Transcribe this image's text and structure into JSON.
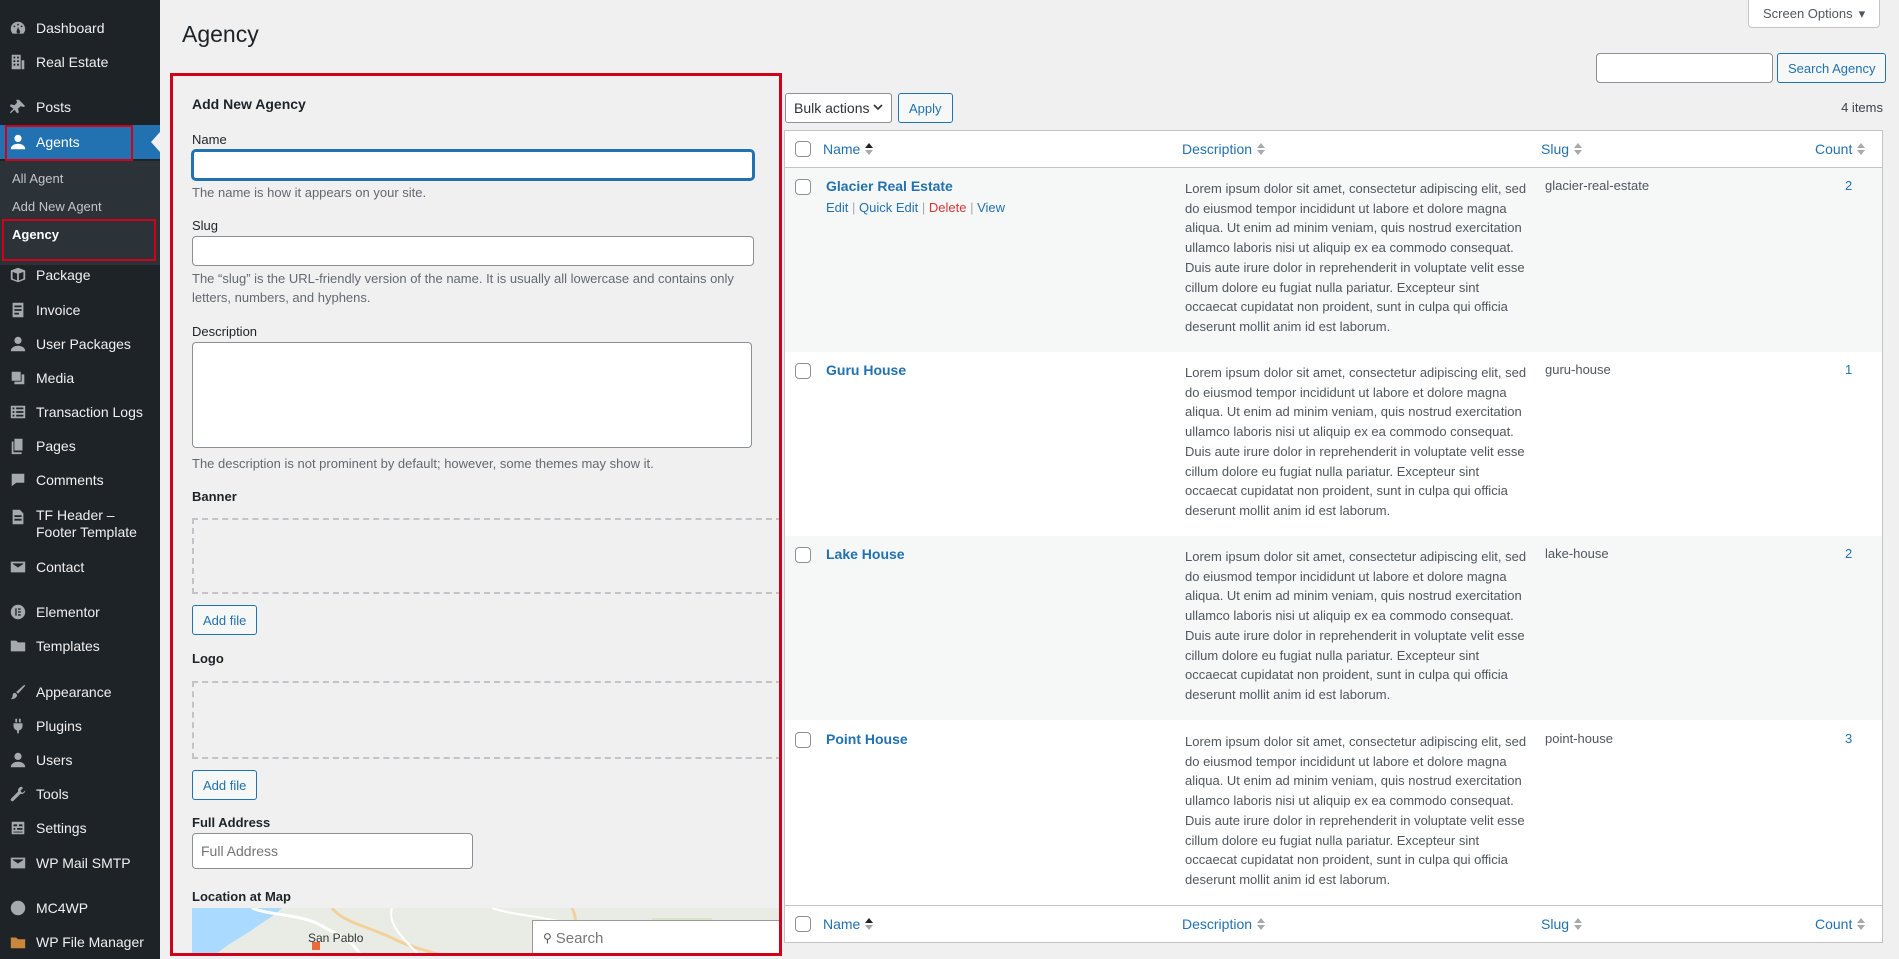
{
  "admin_menu": {
    "items": [
      {
        "label": "Dashboard",
        "icon": "dashboard-icon"
      },
      {
        "label": "Real Estate",
        "icon": "building-icon"
      },
      {
        "label": "Posts",
        "icon": "pushpin-icon"
      },
      {
        "label": "Agents",
        "icon": "user-icon"
      },
      {
        "label": "Package",
        "icon": "package-icon"
      },
      {
        "label": "Invoice",
        "icon": "invoice-icon"
      },
      {
        "label": "User Packages",
        "icon": "user-icon"
      },
      {
        "label": "Media",
        "icon": "media-icon"
      },
      {
        "label": "Transaction Logs",
        "icon": "list-icon"
      },
      {
        "label": "Pages",
        "icon": "pages-icon"
      },
      {
        "label": "Comments",
        "icon": "comment-icon"
      },
      {
        "label": "TF Header –\nFooter Template",
        "icon": "document-icon"
      },
      {
        "label": "Contact",
        "icon": "mail-icon"
      },
      {
        "label": "Elementor",
        "icon": "elementor-icon"
      },
      {
        "label": "Templates",
        "icon": "folder-icon"
      },
      {
        "label": "Appearance",
        "icon": "paintbrush-icon"
      },
      {
        "label": "Plugins",
        "icon": "plugin-icon"
      },
      {
        "label": "Users",
        "icon": "users-icon"
      },
      {
        "label": "Tools",
        "icon": "wrench-icon"
      },
      {
        "label": "Settings",
        "icon": "settings-icon"
      },
      {
        "label": "WP Mail SMTP",
        "icon": "mail-icon"
      },
      {
        "label": "MC4WP",
        "icon": "mc4wp-icon"
      },
      {
        "label": "WP File Manager",
        "icon": "file-manager-icon"
      }
    ],
    "submenu": [
      "All Agent",
      "Add New Agent",
      "Agency"
    ],
    "accent_color": "#2271b1",
    "background_color": "#1d2327"
  },
  "page": {
    "title": "Agency",
    "screen_options": "Screen Options"
  },
  "add_form": {
    "heading": "Add New Agency",
    "name_label": "Name",
    "name_value": "",
    "name_hint": "The name is how it appears on your site.",
    "slug_label": "Slug",
    "slug_value": "",
    "slug_hint": "The “slug” is the URL-friendly version of the name. It is usually all lowercase and contains only letters, numbers, and hyphens.",
    "description_label": "Description",
    "description_hint": "The description is not prominent by default; however, some themes may show it.",
    "banner_label": "Banner",
    "logo_label": "Logo",
    "add_file_label": "Add file",
    "address_label": "Full Address",
    "address_placeholder": "Full Address",
    "map_label": "Location at Map",
    "map_city": "San Pablo",
    "map_search_placeholder": "Search"
  },
  "list": {
    "search_button": "Search Agency",
    "search_value": "",
    "bulk_actions": "Bulk actions",
    "apply": "Apply",
    "items_count": "4 items",
    "columns": {
      "name": "Name",
      "description": "Description",
      "slug": "Slug",
      "count": "Count"
    },
    "row_actions": [
      "Edit",
      "Quick Edit",
      "Delete",
      "View"
    ],
    "rows": [
      {
        "name": "Glacier Real Estate",
        "description": "Lorem ipsum dolor sit amet, consectetur adipiscing elit, sed do eiusmod tempor incididunt ut labore et dolore magna aliqua. Ut enim ad minim veniam, quis nostrud exercitation ullamco laboris nisi ut aliquip ex ea commodo consequat. Duis aute irure dolor in reprehenderit in voluptate velit esse cillum dolore eu fugiat nulla pariatur. Excepteur sint occaecat cupidatat non proident, sunt in culpa qui officia deserunt mollit anim id est laborum.",
        "slug": "glacier-real-estate",
        "count": "2"
      },
      {
        "name": "Guru House",
        "description": "Lorem ipsum dolor sit amet, consectetur adipiscing elit, sed do eiusmod tempor incididunt ut labore et dolore magna aliqua. Ut enim ad minim veniam, quis nostrud exercitation ullamco laboris nisi ut aliquip ex ea commodo consequat. Duis aute irure dolor in reprehenderit in voluptate velit esse cillum dolore eu fugiat nulla pariatur. Excepteur sint occaecat cupidatat non proident, sunt in culpa qui officia deserunt mollit anim id est laborum.",
        "slug": "guru-house",
        "count": "1"
      },
      {
        "name": "Lake House",
        "description": "Lorem ipsum dolor sit amet, consectetur adipiscing elit, sed do eiusmod tempor incididunt ut labore et dolore magna aliqua. Ut enim ad minim veniam, quis nostrud exercitation ullamco laboris nisi ut aliquip ex ea commodo consequat. Duis aute irure dolor in reprehenderit in voluptate velit esse cillum dolore eu fugiat nulla pariatur. Excepteur sint occaecat cupidatat non proident, sunt in culpa qui officia deserunt mollit anim id est laborum.",
        "slug": "lake-house",
        "count": "2"
      },
      {
        "name": "Point House",
        "description": "Lorem ipsum dolor sit amet, consectetur adipiscing elit, sed do eiusmod tempor incididunt ut labore et dolore magna aliqua. Ut enim ad minim veniam, quis nostrud exercitation ullamco laboris nisi ut aliquip ex ea commodo consequat. Duis aute irure dolor in reprehenderit in voluptate velit esse cillum dolore eu fugiat nulla pariatur. Excepteur sint occaecat cupidatat non proident, sunt in culpa qui officia deserunt mollit anim id est laborum.",
        "slug": "point-house",
        "count": "3"
      }
    ]
  },
  "annotation_color": "#d0021b"
}
